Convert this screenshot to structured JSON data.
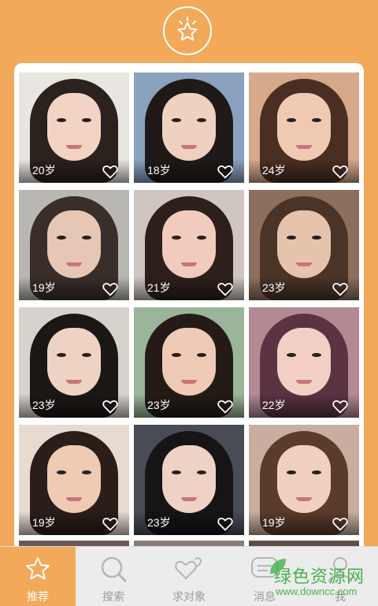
{
  "colors": {
    "accent": "#f2a95a",
    "tabbar_bg": "#ececec",
    "tab_inactive_text": "#9a9a9a",
    "watermark_green": "#47b24a"
  },
  "header": {
    "logo_icon": "star-badge-icon"
  },
  "cards": [
    {
      "age": "20岁",
      "bg": "#e9e6e2",
      "hair": "#2b211d",
      "face": "#f3d4c4"
    },
    {
      "age": "18岁",
      "bg": "#8aa2be",
      "hair": "#1f1a18",
      "face": "#efd1c0"
    },
    {
      "age": "24岁",
      "bg": "#d6a98c",
      "hair": "#4b2e22",
      "face": "#f0c9b2"
    },
    {
      "age": "19岁",
      "bg": "#b9b7b2",
      "hair": "#3a2e2a",
      "face": "#e6c7b5"
    },
    {
      "age": "21岁",
      "bg": "#cfc6c2",
      "hair": "#2d201c",
      "face": "#f1cbbd"
    },
    {
      "age": "23岁",
      "bg": "#8d6f5d",
      "hair": "#4a3428",
      "face": "#e6c3ac"
    },
    {
      "age": "23岁",
      "bg": "#d7d2cb",
      "hair": "#1b1715",
      "face": "#efd3c2"
    },
    {
      "age": "23岁",
      "bg": "#9bb59a",
      "hair": "#241b17",
      "face": "#efcbb7"
    },
    {
      "age": "22岁",
      "bg": "#b38a93",
      "hair": "#5b3342",
      "face": "#f3cfc4"
    },
    {
      "age": "19岁",
      "bg": "#e7dad0",
      "hair": "#2b1e19",
      "face": "#efcbb4"
    },
    {
      "age": "23岁",
      "bg": "#4a4c55",
      "hair": "#161414",
      "face": "#eed2c5"
    },
    {
      "age": "19岁",
      "bg": "#c9aea0",
      "hair": "#5a3b2c",
      "face": "#f1d0c0"
    }
  ],
  "tabs": [
    {
      "label": "推荐",
      "icon": "star-icon",
      "active": true
    },
    {
      "label": "搜索",
      "icon": "search-icon",
      "active": false
    },
    {
      "label": "求对象",
      "icon": "hearts-icon",
      "active": false
    },
    {
      "label": "消息",
      "icon": "chat-bubble-icon",
      "active": false
    },
    {
      "label": "我",
      "icon": "person-icon",
      "active": false
    }
  ],
  "watermark": {
    "title": "绿色资源网",
    "url": "www.downcc.com"
  }
}
